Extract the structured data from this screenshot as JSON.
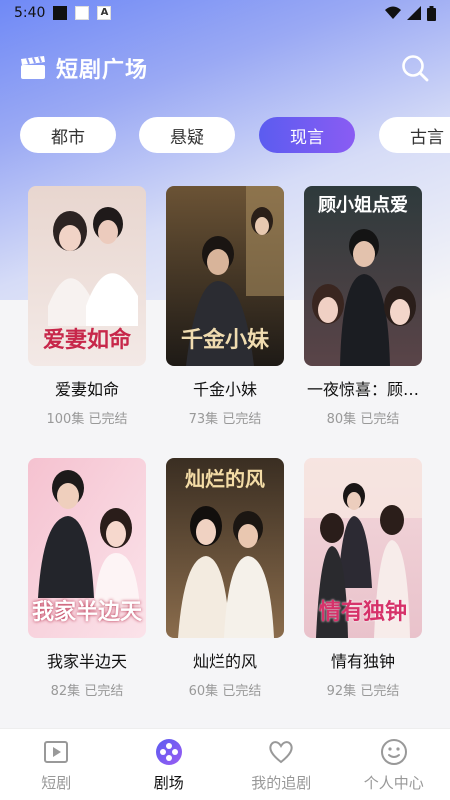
{
  "status_bar": {
    "time": "5:40"
  },
  "header": {
    "title": "短剧广场",
    "icon": "clapperboard-icon",
    "search_icon": "search-icon"
  },
  "tabs": [
    {
      "label": "都市",
      "active": false
    },
    {
      "label": "悬疑",
      "active": false
    },
    {
      "label": "现言",
      "active": true
    },
    {
      "label": "古言",
      "active": false
    }
  ],
  "dramas": [
    {
      "title": "爱妻如命",
      "episodes": "100集",
      "status": "已完结",
      "poster_text": "爱妻如命"
    },
    {
      "title": "千金小妹",
      "episodes": "73集",
      "status": "已完结",
      "poster_text": "千金小妹"
    },
    {
      "title": "一夜惊喜：顾…",
      "episodes": "80集",
      "status": "已完结",
      "poster_text": "顾小姐点爱"
    },
    {
      "title": "我家半边天",
      "episodes": "82集",
      "status": "已完结",
      "poster_text": "我家半边天"
    },
    {
      "title": "灿烂的风",
      "episodes": "60集",
      "status": "已完结",
      "poster_text": "灿烂的风"
    },
    {
      "title": "情有独钟",
      "episodes": "92集",
      "status": "已完结",
      "poster_text": "情有独钟"
    }
  ],
  "bottom_nav": [
    {
      "label": "短剧",
      "icon": "play-icon",
      "active": false
    },
    {
      "label": "剧场",
      "icon": "film-reel-icon",
      "active": true
    },
    {
      "label": "我的追剧",
      "icon": "heart-icon",
      "active": false
    },
    {
      "label": "个人中心",
      "icon": "smiley-icon",
      "active": false
    }
  ],
  "colors": {
    "accent": "#6a5cf2",
    "header_gradient_top": "#6f89f6",
    "muted_text": "#999999"
  }
}
